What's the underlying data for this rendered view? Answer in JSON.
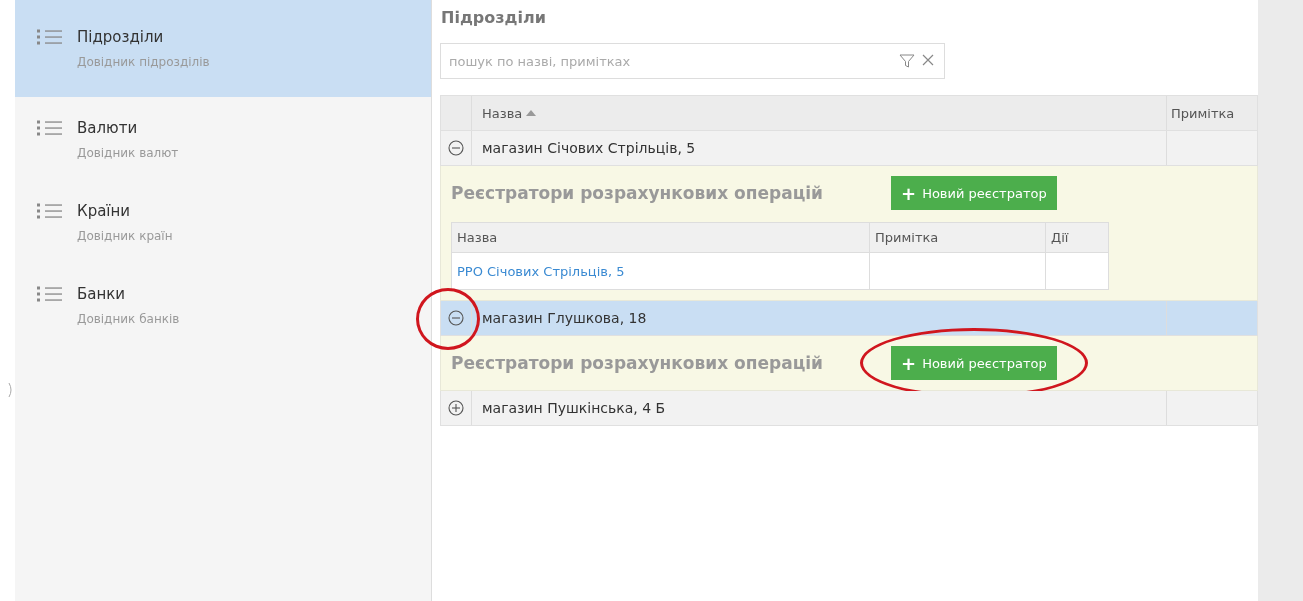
{
  "sidebar": {
    "items": [
      {
        "title": "Підрозділи",
        "subtitle": "Довідник підрозділів",
        "selected": true
      },
      {
        "title": "Валюти",
        "subtitle": "Довідник валют",
        "selected": false
      },
      {
        "title": "Країни",
        "subtitle": "Довідник країн",
        "selected": false
      },
      {
        "title": "Банки",
        "subtitle": "Довідник банків",
        "selected": false
      }
    ]
  },
  "main": {
    "title": "Підрозділи",
    "search": {
      "placeholder": "пошук по назві, примітках"
    },
    "table": {
      "columns": [
        {
          "label": "Назва",
          "sorted": true
        },
        {
          "label": "Примітка",
          "sorted": false
        }
      ],
      "rows": [
        {
          "name": "магазин Січових Стрільців, 5",
          "expanded": true,
          "selected": false,
          "highlighted": false,
          "detail": {
            "title": "Реєстратори розрахункових операцій",
            "button": {
              "icon": "+",
              "label": "Новий реєстратор",
              "highlighted": false
            },
            "table": {
              "columns": [
                "Назва",
                "Примітка",
                "Дії"
              ],
              "rows": [
                {
                  "name": "РРО Січових Стрільців, 5"
                }
              ]
            }
          }
        },
        {
          "name": "магазин Глушкова, 18",
          "expanded": true,
          "selected": true,
          "highlighted": true,
          "detail": {
            "title": "Реєстратори розрахункових операцій",
            "button": {
              "icon": "+",
              "label": "Новий реєстратор",
              "highlighted": true
            }
          }
        },
        {
          "name": "магазин Пушкінська, 4 Б",
          "expanded": false,
          "selected": false,
          "highlighted": false
        }
      ]
    }
  }
}
